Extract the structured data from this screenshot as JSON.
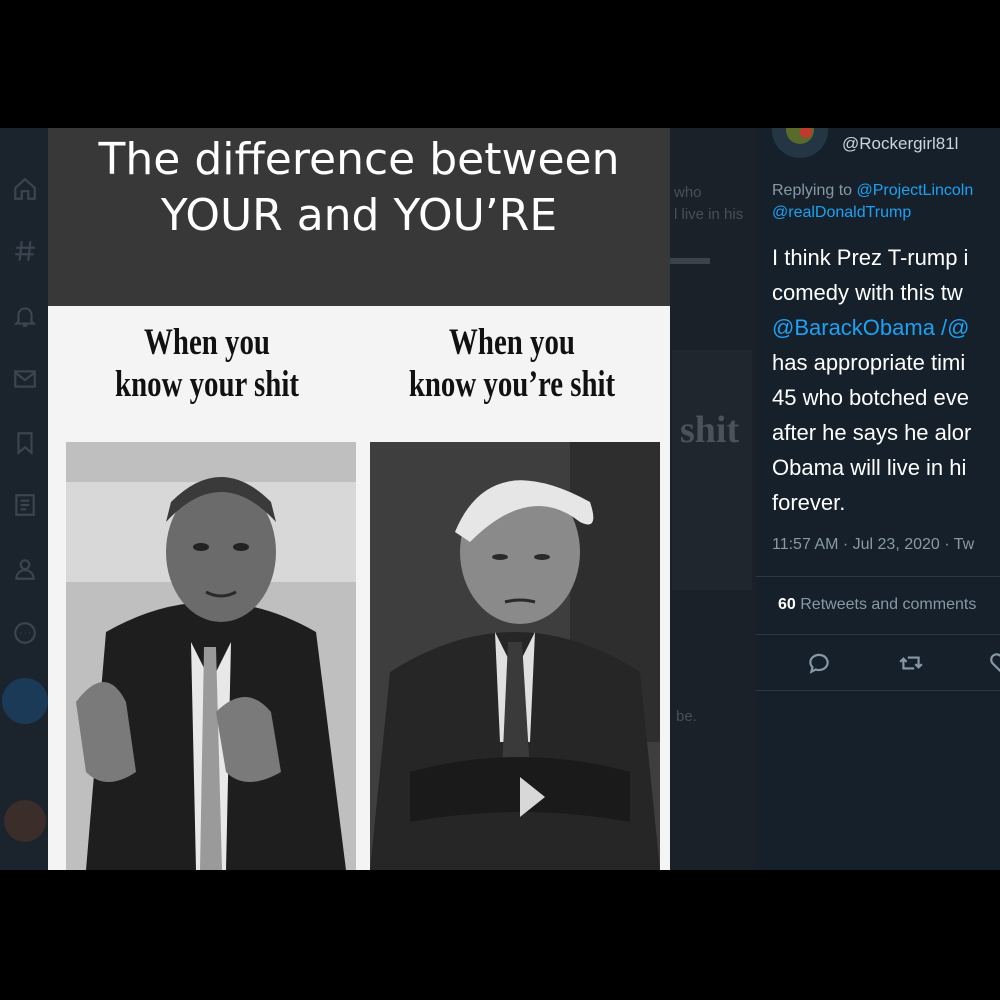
{
  "meme": {
    "title_line1": "The difference between",
    "title_line2": "YOUR and YOU’RE",
    "caption_left_line1": "When you",
    "caption_left_line2": "know your shit",
    "caption_right_line1": "When you",
    "caption_right_line2": "know you’re shit"
  },
  "background_timeline": {
    "text1": "who",
    "text2": "l live in his",
    "text3": "shit",
    "text4": "be."
  },
  "tweet": {
    "handle": "@Rockergirl81l",
    "replying_prefix": "Replying to ",
    "reply_to_1": "@ProjectLincoln",
    "reply_to_2": "@realDonaldTrump",
    "body_lines": [
      "I think Prez T-rump i",
      "comedy with this tw",
      "@BarackObama /@",
      "has appropriate timi",
      "45 who botched eve",
      "after he says he alor",
      "Obama will live in hi",
      "forever."
    ],
    "timestamp": "11:57 AM · Jul 23, 2020 · Tw",
    "retweets_count": "60",
    "retweets_label": " Retweets and comments"
  },
  "icons": [
    "home-icon",
    "hashtag-icon",
    "bell-icon",
    "mail-icon",
    "bookmark-icon",
    "list-icon",
    "profile-icon",
    "more-icon",
    "compose-icon",
    "reply-icon",
    "retweet-icon",
    "like-icon"
  ],
  "colors": {
    "link": "#1da1f2",
    "tweet_bg": "#15202b",
    "muted": "#8899a6"
  }
}
